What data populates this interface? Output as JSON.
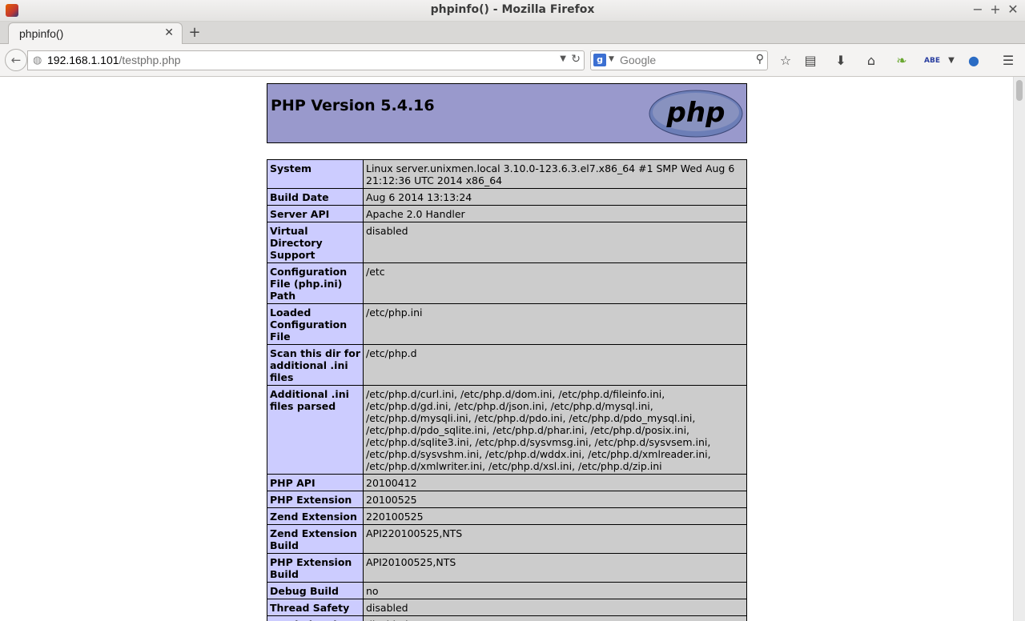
{
  "window": {
    "title": "phpinfo() - Mozilla Firefox",
    "min_icon": "minimize-icon",
    "max_icon": "maximize-icon",
    "close_icon": "close-icon"
  },
  "tabs": [
    {
      "label": "phpinfo()"
    }
  ],
  "nav": {
    "url_host": "192.168.1.101",
    "url_path": "/testphp.php",
    "search_placeholder": "Google"
  },
  "page": {
    "header": "PHP Version 5.4.16",
    "logo_text": "php",
    "rows": [
      {
        "key": "System",
        "value": "Linux server.unixmen.local 3.10.0-123.6.3.el7.x86_64 #1 SMP Wed Aug 6 21:12:36 UTC 2014 x86_64"
      },
      {
        "key": "Build Date",
        "value": "Aug 6 2014 13:13:24"
      },
      {
        "key": "Server API",
        "value": "Apache 2.0 Handler"
      },
      {
        "key": "Virtual Directory Support",
        "value": "disabled"
      },
      {
        "key": "Configuration File (php.ini) Path",
        "value": "/etc"
      },
      {
        "key": "Loaded Configuration File",
        "value": "/etc/php.ini"
      },
      {
        "key": "Scan this dir for additional .ini files",
        "value": "/etc/php.d"
      },
      {
        "key": "Additional .ini files parsed",
        "value": "/etc/php.d/curl.ini, /etc/php.d/dom.ini, /etc/php.d/fileinfo.ini, /etc/php.d/gd.ini, /etc/php.d/json.ini, /etc/php.d/mysql.ini, /etc/php.d/mysqli.ini, /etc/php.d/pdo.ini, /etc/php.d/pdo_mysql.ini, /etc/php.d/pdo_sqlite.ini, /etc/php.d/phar.ini, /etc/php.d/posix.ini, /etc/php.d/sqlite3.ini, /etc/php.d/sysvmsg.ini, /etc/php.d/sysvsem.ini, /etc/php.d/sysvshm.ini, /etc/php.d/wddx.ini, /etc/php.d/xmlreader.ini, /etc/php.d/xmlwriter.ini, /etc/php.d/xsl.ini, /etc/php.d/zip.ini"
      },
      {
        "key": "PHP API",
        "value": "20100412"
      },
      {
        "key": "PHP Extension",
        "value": "20100525"
      },
      {
        "key": "Zend Extension",
        "value": "220100525"
      },
      {
        "key": "Zend Extension Build",
        "value": "API220100525,NTS"
      },
      {
        "key": "PHP Extension Build",
        "value": "API20100525,NTS"
      },
      {
        "key": "Debug Build",
        "value": "no"
      },
      {
        "key": "Thread Safety",
        "value": "disabled"
      },
      {
        "key": "Zend Signal Handling",
        "value": "disabled"
      }
    ]
  },
  "colors": {
    "header_bg": "#9999cc",
    "key_bg": "#ccccff",
    "value_bg": "#cccccc"
  }
}
